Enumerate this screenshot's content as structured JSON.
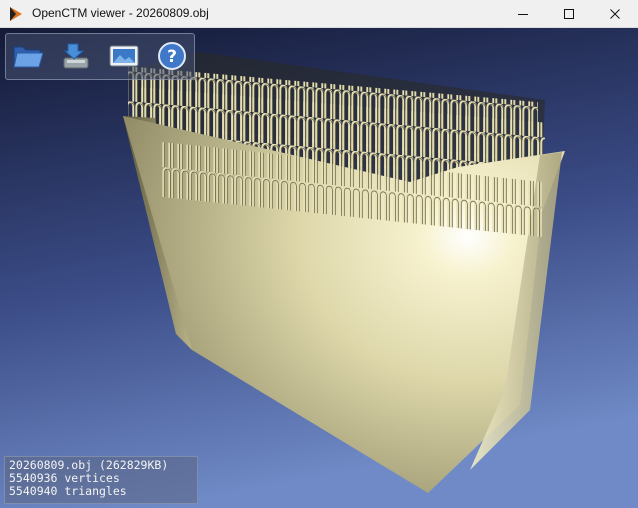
{
  "window": {
    "title": "OpenCTM viewer - 20260809.obj",
    "minimize_glyph": "—",
    "maximize_glyph": "☐",
    "close_glyph": "✕"
  },
  "toolbar": {
    "items": [
      {
        "name": "open-file",
        "icon": "folder-open-icon"
      },
      {
        "name": "save-file",
        "icon": "save-download-icon"
      },
      {
        "name": "texture",
        "icon": "image-icon"
      },
      {
        "name": "help",
        "icon": "help-icon"
      }
    ]
  },
  "info": {
    "file_line": "20260809.obj (262829KB)",
    "vertices_line": "5540936 vertices",
    "triangles_line": "5540940 triangles"
  },
  "colors": {
    "bg_top": "#1a2040",
    "bg_bottom": "#6c86c3",
    "model_light": "#fffbe0",
    "model_mid": "#dcd6aa",
    "model_dark": "#6f6a48",
    "pin_stroke": "#3d3a28"
  }
}
